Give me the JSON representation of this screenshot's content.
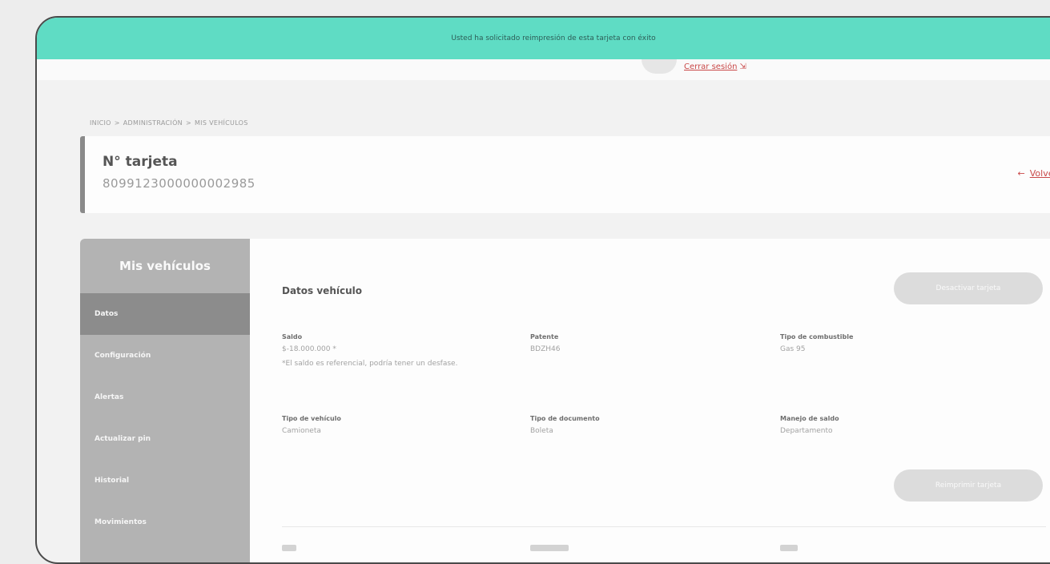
{
  "toast": {
    "message": "Usted ha solicitado reimpresión de esta tarjeta con éxito"
  },
  "topbar": {
    "logout_label": "Cerrar sesión"
  },
  "breadcrumb": {
    "items": [
      "INICIO",
      "ADMINISTRACIÓN",
      "MIS VEHÍCULOS"
    ],
    "separator": ">"
  },
  "card": {
    "title": "N° tarjeta",
    "number": "8099123000000002985",
    "back_label": "Volver",
    "back_arrow": "←"
  },
  "sidebar": {
    "title": "Mis vehículos",
    "items": [
      {
        "label": "Datos",
        "active": true
      },
      {
        "label": "Configuración"
      },
      {
        "label": "Alertas"
      },
      {
        "label": "Actualizar pin"
      },
      {
        "label": "Historial"
      },
      {
        "label": "Movimientos"
      }
    ]
  },
  "vehicle": {
    "section_title": "Datos vehículo",
    "deactivate_label": "Desactivar tarjeta",
    "reprint_label": "Reimprimir tarjeta",
    "fields": [
      {
        "label": "Saldo",
        "value": "$-18.000.000 *",
        "note": "*El saldo es referencial, podría tener un desfase."
      },
      {
        "label": "Patente",
        "value": "BDZH46"
      },
      {
        "label": "Tipo de combustible",
        "value": "Gas 95"
      },
      {
        "label": "Tipo de vehículo",
        "value": "Camioneta"
      },
      {
        "label": "Tipo de documento",
        "value": "Boleta"
      },
      {
        "label": "Manejo de saldo",
        "value": "Departamento"
      }
    ]
  },
  "colors": {
    "toast_bg": "#5fdcc4",
    "sidebar_bg": "#b3b3b3",
    "sidebar_active": "#8c8c8c",
    "link_red": "#c94848"
  }
}
